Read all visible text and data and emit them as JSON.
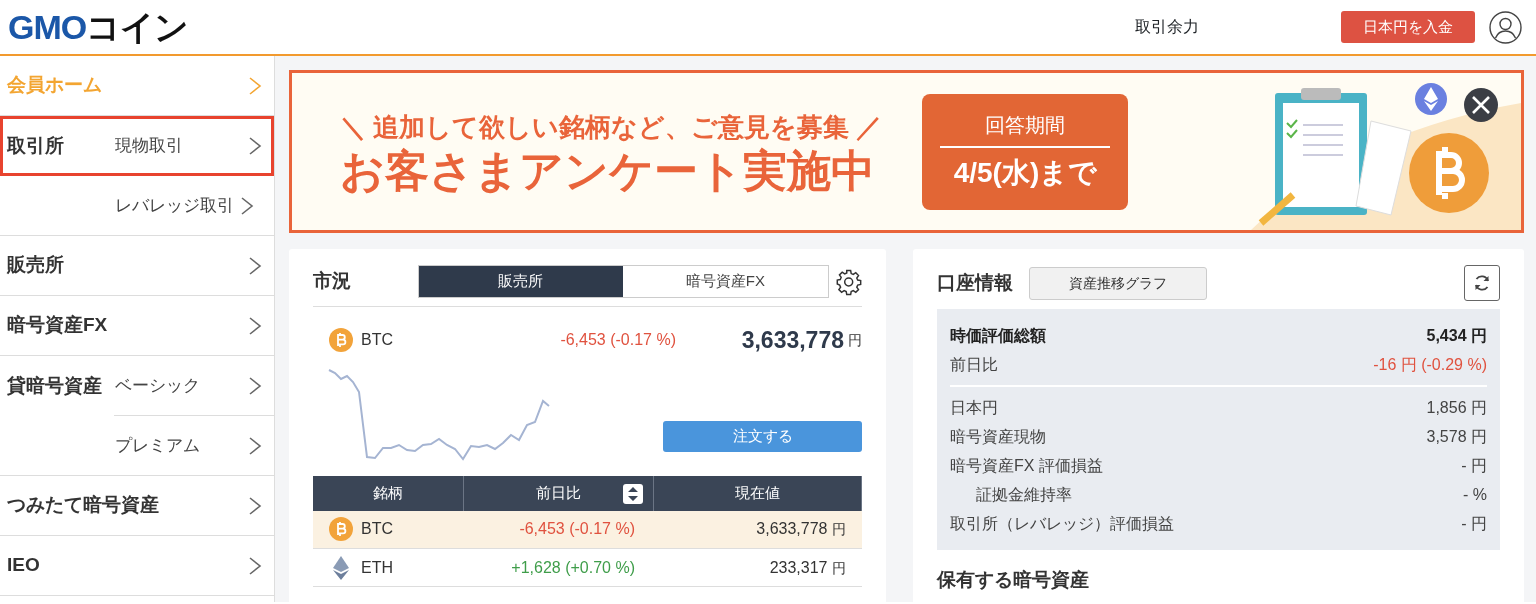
{
  "header": {
    "logo": {
      "primary": "GMO",
      "secondary": "コイン"
    },
    "balance_link": "取引余力",
    "deposit_button": "日本円を入金"
  },
  "sidebar": {
    "items": [
      {
        "label": "会員ホーム",
        "selected": true
      },
      {
        "label": "取引所",
        "selected": false,
        "subitems": [
          {
            "label": "現物取引",
            "highlighted": true
          },
          {
            "label": "レバレッジ取引",
            "highlighted": false
          }
        ]
      },
      {
        "label": "販売所",
        "selected": false
      },
      {
        "label": "暗号資産FX",
        "selected": false
      },
      {
        "label": "貸暗号資産",
        "selected": false,
        "subitems": [
          {
            "label": "ベーシック",
            "highlighted": false
          },
          {
            "label": "プレミアム",
            "highlighted": false
          }
        ]
      },
      {
        "label": "つみたて暗号資産",
        "selected": false
      },
      {
        "label": "IEO",
        "selected": false
      }
    ]
  },
  "banner": {
    "tagline": "＼ 追加して欲しい銘柄など、ご意見を募集 ／",
    "headline": "お客さまアンケート実施中",
    "period_label": "回答期間",
    "period_date": "4/5(水)まで"
  },
  "market": {
    "title": "市況",
    "tabs": [
      {
        "label": "販売所",
        "selected": true
      },
      {
        "label": "暗号資産FX",
        "selected": false
      }
    ],
    "featured": {
      "kind": "btc",
      "symbol": "BTC",
      "change": "-6,453 (-0.17 %)",
      "color": "#e0523f",
      "price": "3,633,778",
      "unit": "円"
    },
    "order_button": "注文する",
    "table": {
      "columns": [
        "銘柄",
        "前日比",
        "現在値"
      ],
      "rows": [
        {
          "kind": "btc",
          "symbol": "BTC",
          "change": "-6,453 (-0.17 %)",
          "color": "#e0523f",
          "price": "3,633,778",
          "unit": "円",
          "selected": true
        },
        {
          "kind": "eth",
          "symbol": "ETH",
          "change": "+1,628 (+0.70 %)",
          "color": "#3f9d4a",
          "price": "233,317",
          "unit": "円",
          "selected": false
        }
      ]
    }
  },
  "account": {
    "title": "口座情報",
    "graph_button": "資産推移グラフ",
    "rows": [
      {
        "kind": "total",
        "label": "時価評価総額",
        "value": "5,434 円"
      },
      {
        "kind": "change",
        "label": "前日比",
        "value": "-16 円 (-0.29 %)"
      },
      {
        "kind": "item",
        "label": "日本円",
        "value": "1,856 円"
      },
      {
        "kind": "item",
        "label": "暗号資産現物",
        "value": "3,578 円"
      },
      {
        "kind": "item",
        "label": "暗号資産FX 評価損益",
        "value": "- 円"
      },
      {
        "kind": "sub",
        "label": "証拠金維持率",
        "value": "- %"
      },
      {
        "kind": "item",
        "label": "取引所（レバレッジ）評価損益",
        "value": "- 円"
      }
    ],
    "holdings_title": "保有する暗号資産"
  }
}
